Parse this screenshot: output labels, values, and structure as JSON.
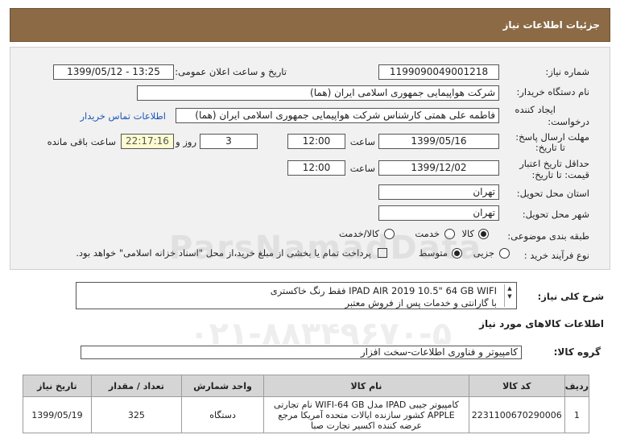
{
  "header": {
    "title": "جزئیات اطلاعات نیاز"
  },
  "form": {
    "need_number_label": "شماره نیاز:",
    "need_number": "1199090049001218",
    "announce_label": "تاریخ و ساعت اعلان عمومی:",
    "announce_value": "1399/05/12 - 13:25",
    "buyer_org_label": "نام دستگاه خریدار:",
    "buyer_org": "شرکت هواپیمایی جمهوری اسلامی ایران (هما)",
    "creator_label_1": "ایجاد کننده",
    "creator_label_2": "درخواست:",
    "creator": "فاطمه علی همتی کارشناس شرکت هواپیمایی جمهوری اسلامی ایران (هما)",
    "contact_link": "اطلاعات تماس خریدار",
    "reply_deadline_label_1": "مهلت ارسال پاسخ:",
    "reply_deadline_label_2": "تا تاریخ:",
    "reply_date": "1399/05/16",
    "time_label": "ساعت",
    "reply_time": "12:00",
    "days_value": "3",
    "days_label": "روز و",
    "remaining_time": "22:17:16",
    "remaining_label": "ساعت باقی مانده",
    "price_valid_label_1": "حداقل تاریخ اعتبار",
    "price_valid_label_2": "قیمت: تا تاریخ:",
    "price_valid_date": "1399/12/02",
    "price_valid_time": "12:00",
    "province_label": "استان محل تحویل:",
    "province": "تهران",
    "city_label": "شهر محل تحویل:",
    "city": "تهران",
    "category_label": "طبقه بندی موضوعی:",
    "category_options": [
      "کالا",
      "خدمت",
      "کالا/خدمت"
    ],
    "category_selected": "کالا",
    "process_label": "نوع فرآیند خرید :",
    "process_options": [
      "جزیی",
      "متوسط"
    ],
    "process_selected": "متوسط",
    "payment_note": "پرداخت تمام یا بخشی از مبلغ خرید،از محل \"اسناد خزانه اسلامی\" خواهد بود."
  },
  "description": {
    "label": "شرح کلی نیاز:",
    "line1": "IPAD AIR 2019 10.5\" 64 GB WIFI فقط رنگ خاکستری",
    "line2": "با گارانتی و خدمات پس از فروش معتبر"
  },
  "goods_section": {
    "title": "اطلاعات کالاهای مورد نیاز",
    "group_label": "گروه کالا:",
    "group_value": "کامپیوتر و فناوری اطلاعات-سخت افزار"
  },
  "table": {
    "headers": [
      "ردیف",
      "کد کالا",
      "نام کالا",
      "واحد شمارش",
      "تعداد / مقدار",
      "تاریخ نیاز"
    ],
    "rows": [
      {
        "row": "1",
        "code": "2231100670290006",
        "name": "کامپیوتر جیبی IPAD مدل WIFI-64 GB نام تجارتی APPLE کشور سازنده ایالات متحده آمریکا مرجع عرضه کننده اکسیر تجارت صبا",
        "unit": "دستگاه",
        "qty": "325",
        "date": "1399/05/19"
      }
    ]
  },
  "watermark": {
    "text": "ParsNamadData",
    "phone": "۰۲۱-۸۸۳۴۹۶۷۰-۵"
  },
  "colors": {
    "title_bg": "#8b6a45",
    "panel_bg": "#f1f1f1",
    "link": "#1a55b5",
    "remaining_bg": "#fdfbd1"
  }
}
